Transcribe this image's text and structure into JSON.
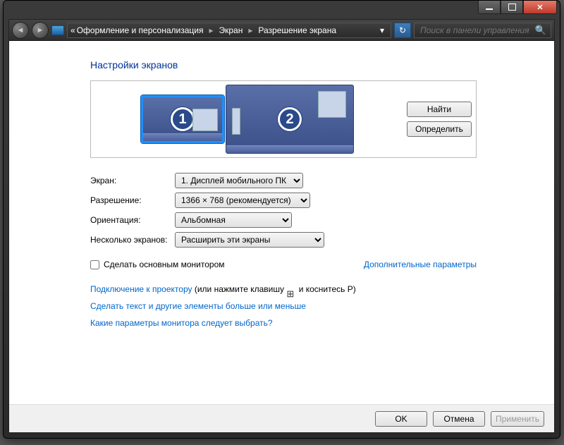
{
  "titlebar": {
    "min": "",
    "max": "",
    "close": ""
  },
  "nav": {
    "breadcrumb": {
      "prefix": "«",
      "p1": "Оформление и персонализация",
      "p2": "Экран",
      "p3": "Разрешение экрана"
    },
    "search_placeholder": "Поиск в панели управления"
  },
  "page_title": "Настройки экранов",
  "arrange": {
    "find": "Найти",
    "identify": "Определить",
    "mon1_num": "1",
    "mon2_num": "2"
  },
  "form": {
    "display_label": "Экран:",
    "display_value": "1. Дисплей мобильного ПК",
    "resolution_label": "Разрешение:",
    "resolution_value": "1366 × 768 (рекомендуется)",
    "orientation_label": "Ориентация:",
    "orientation_value": "Альбомная",
    "multi_label": "Несколько экранов:",
    "multi_value": "Расширить эти экраны"
  },
  "make_main": "Сделать основным монитором",
  "advanced": "Дополнительные параметры",
  "links": {
    "projector_a": "Подключение к проектору",
    "projector_b": " (или нажмите клавишу ",
    "projector_c": " и коснитесь P)",
    "textsize": "Сделать текст и другие элементы больше или меньше",
    "which": "Какие параметры монитора следует выбрать?"
  },
  "footer": {
    "ok": "OK",
    "cancel": "Отмена",
    "apply": "Применить"
  }
}
